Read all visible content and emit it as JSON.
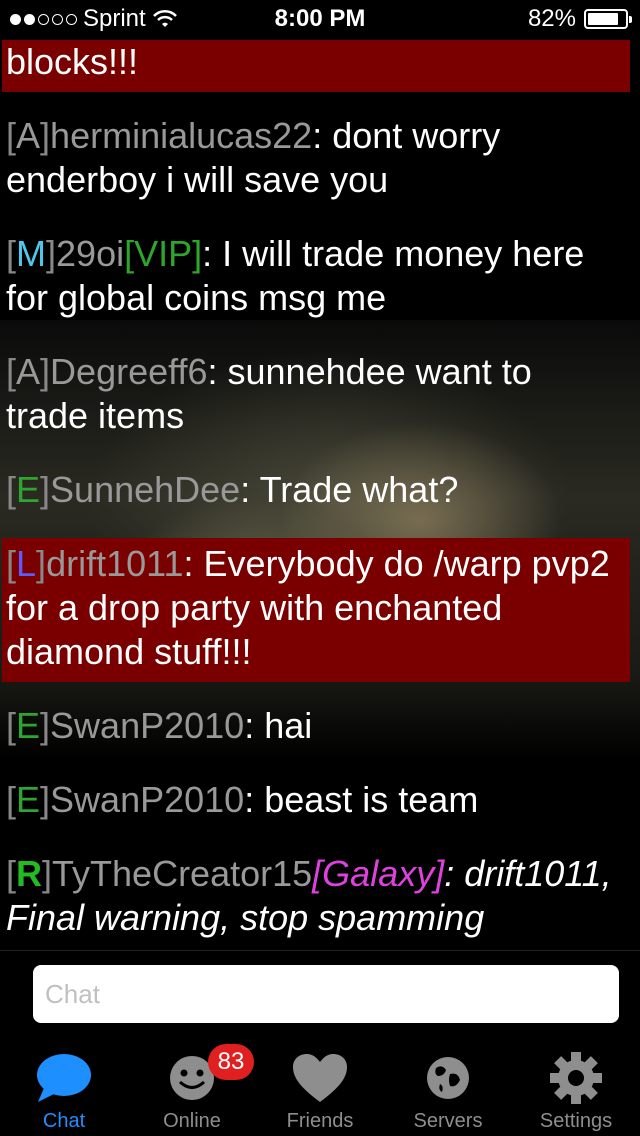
{
  "status": {
    "carrier": "Sprint",
    "time": "8:00 PM",
    "battery": "82%",
    "battery_level": 0.82
  },
  "messages": [
    {
      "highlight": true,
      "text": "blocks!!!"
    },
    {
      "tag": "A",
      "name": "herminialucas22",
      "text": ": dont worry enderboy i will save you"
    },
    {
      "tag": "M",
      "name": "29oi",
      "suffix": "VIP",
      "text": ": I will trade money here for global coins msg me"
    },
    {
      "tag": "A",
      "name": "Degreeff6",
      "text": ": sunnehdee want to trade items"
    },
    {
      "tag": "E",
      "name": "SunnehDee",
      "text": ": Trade what?"
    },
    {
      "highlight": true,
      "tag": "L",
      "name": "drift1011",
      "text": ": Everybody do /warp pvp2 for a drop party with enchanted diamond stuff!!!"
    },
    {
      "tag": "E",
      "name": "SwanP2010",
      "text": ": hai"
    },
    {
      "tag": "E",
      "name": "SwanP2010",
      "text": ": beast is team"
    },
    {
      "tag": "R",
      "name": "TyTheCreator15",
      "suffix": "Galaxy",
      "text": ": drift1011, Final warning, stop spamming"
    }
  ],
  "chat_input": {
    "placeholder": "Chat",
    "value": ""
  },
  "tabs": [
    {
      "label": "Chat",
      "icon": "speech-bubble-icon",
      "active": true
    },
    {
      "label": "Online",
      "icon": "smiley-icon",
      "badge": "83"
    },
    {
      "label": "Friends",
      "icon": "heart-icon"
    },
    {
      "label": "Servers",
      "icon": "globe-icon"
    },
    {
      "label": "Settings",
      "icon": "gear-icon"
    }
  ],
  "colors": {
    "highlight": "#7a0000",
    "accent": "#1e8fff",
    "badge": "#e02020",
    "vip": "#2ea62e",
    "galaxy": "#e040e0"
  }
}
